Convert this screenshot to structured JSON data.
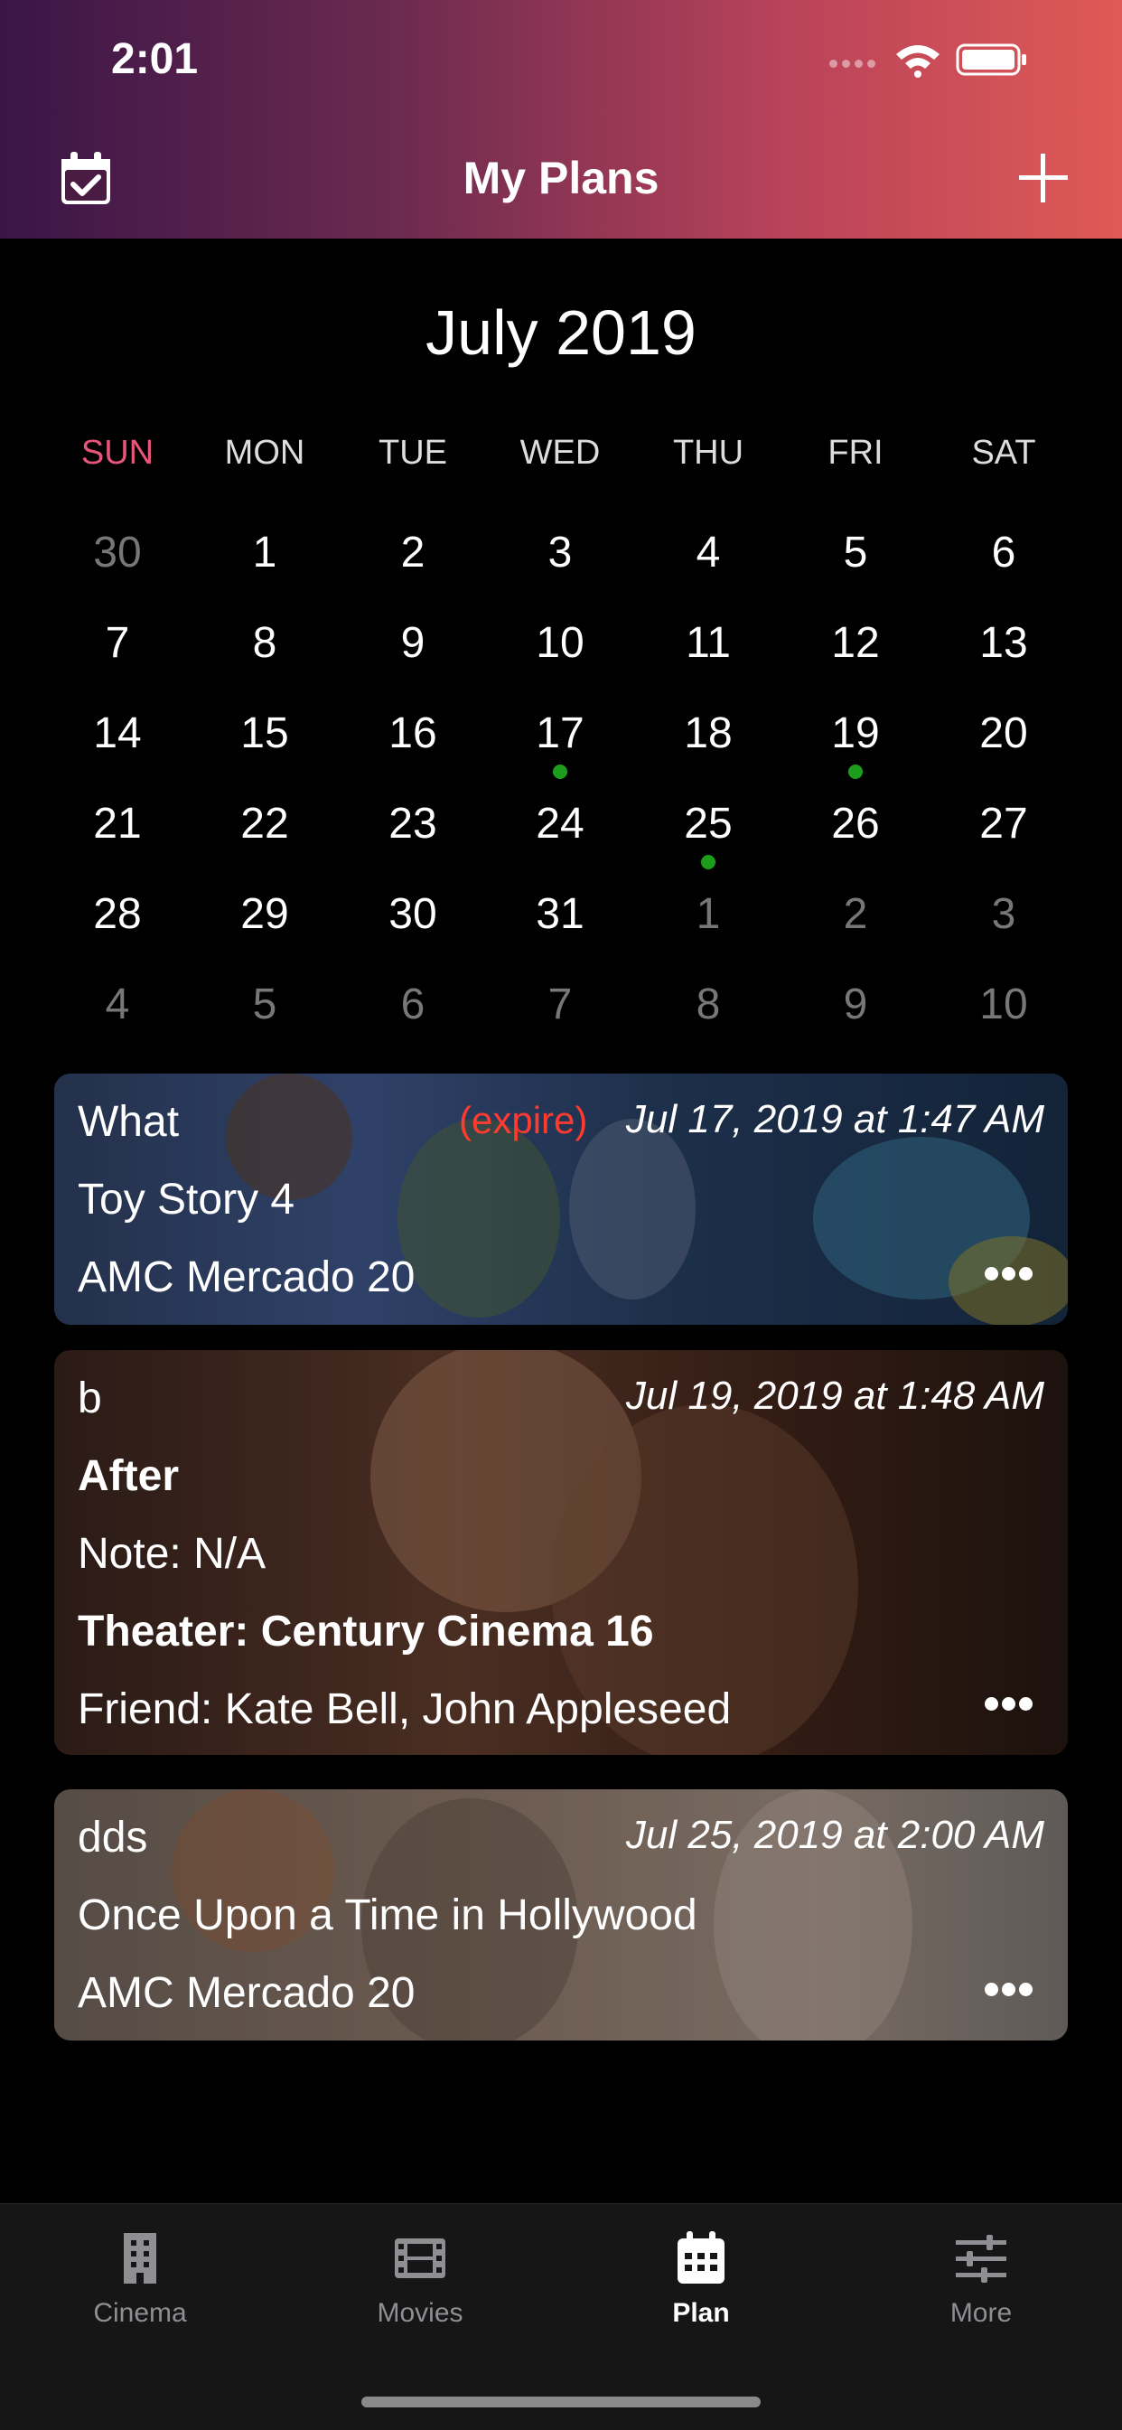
{
  "status_bar": {
    "time": "2:01"
  },
  "header": {
    "title": "My Plans",
    "left_icon": "calendar-check-icon",
    "right_icon": "plus-icon"
  },
  "calendar": {
    "month_title": "July 2019",
    "weekdays": [
      "SUN",
      "MON",
      "TUE",
      "WED",
      "THU",
      "FRI",
      "SAT"
    ],
    "weeks": [
      [
        {
          "d": "30",
          "m": true
        },
        {
          "d": "1"
        },
        {
          "d": "2"
        },
        {
          "d": "3"
        },
        {
          "d": "4"
        },
        {
          "d": "5"
        },
        {
          "d": "6"
        }
      ],
      [
        {
          "d": "7"
        },
        {
          "d": "8"
        },
        {
          "d": "9"
        },
        {
          "d": "10"
        },
        {
          "d": "11"
        },
        {
          "d": "12"
        },
        {
          "d": "13"
        }
      ],
      [
        {
          "d": "14"
        },
        {
          "d": "15"
        },
        {
          "d": "16"
        },
        {
          "d": "17",
          "event": true
        },
        {
          "d": "18"
        },
        {
          "d": "19",
          "event": true
        },
        {
          "d": "20"
        }
      ],
      [
        {
          "d": "21"
        },
        {
          "d": "22"
        },
        {
          "d": "23"
        },
        {
          "d": "24"
        },
        {
          "d": "25",
          "event": true
        },
        {
          "d": "26"
        },
        {
          "d": "27"
        }
      ],
      [
        {
          "d": "28"
        },
        {
          "d": "29"
        },
        {
          "d": "30"
        },
        {
          "d": "31"
        },
        {
          "d": "1",
          "m": true
        },
        {
          "d": "2",
          "m": true
        },
        {
          "d": "3",
          "m": true
        }
      ],
      [
        {
          "d": "4",
          "m": true
        },
        {
          "d": "5",
          "m": true
        },
        {
          "d": "6",
          "m": true
        },
        {
          "d": "7",
          "m": true
        },
        {
          "d": "8",
          "m": true
        },
        {
          "d": "9",
          "m": true
        },
        {
          "d": "10",
          "m": true
        }
      ]
    ],
    "event_dot_color": "#1c9e1c",
    "sunday_color": "#e8557a"
  },
  "plans": [
    {
      "name": "What",
      "expire_label": "(expire)",
      "datetime": "Jul 17, 2019 at 1:47 AM",
      "movie": "Toy Story 4",
      "theater": "AMC Mercado 20"
    },
    {
      "name": "b",
      "datetime": "Jul 19, 2019 at 1:48 AM",
      "movie": "After",
      "note": "Note: N/A",
      "theater": "Theater: Century Cinema 16",
      "friends": "Friend: Kate Bell, John Appleseed"
    },
    {
      "name": "dds",
      "datetime": "Jul 25, 2019 at 2:00 AM",
      "movie": "Once Upon a Time in Hollywood",
      "theater": "AMC Mercado 20"
    }
  ],
  "tabbar": {
    "tabs": [
      {
        "label": "Cinema",
        "icon": "building-icon"
      },
      {
        "label": "Movies",
        "icon": "film-icon"
      },
      {
        "label": "Plan",
        "icon": "calendar-icon",
        "active": true
      },
      {
        "label": "More",
        "icon": "sliders-icon"
      }
    ]
  }
}
